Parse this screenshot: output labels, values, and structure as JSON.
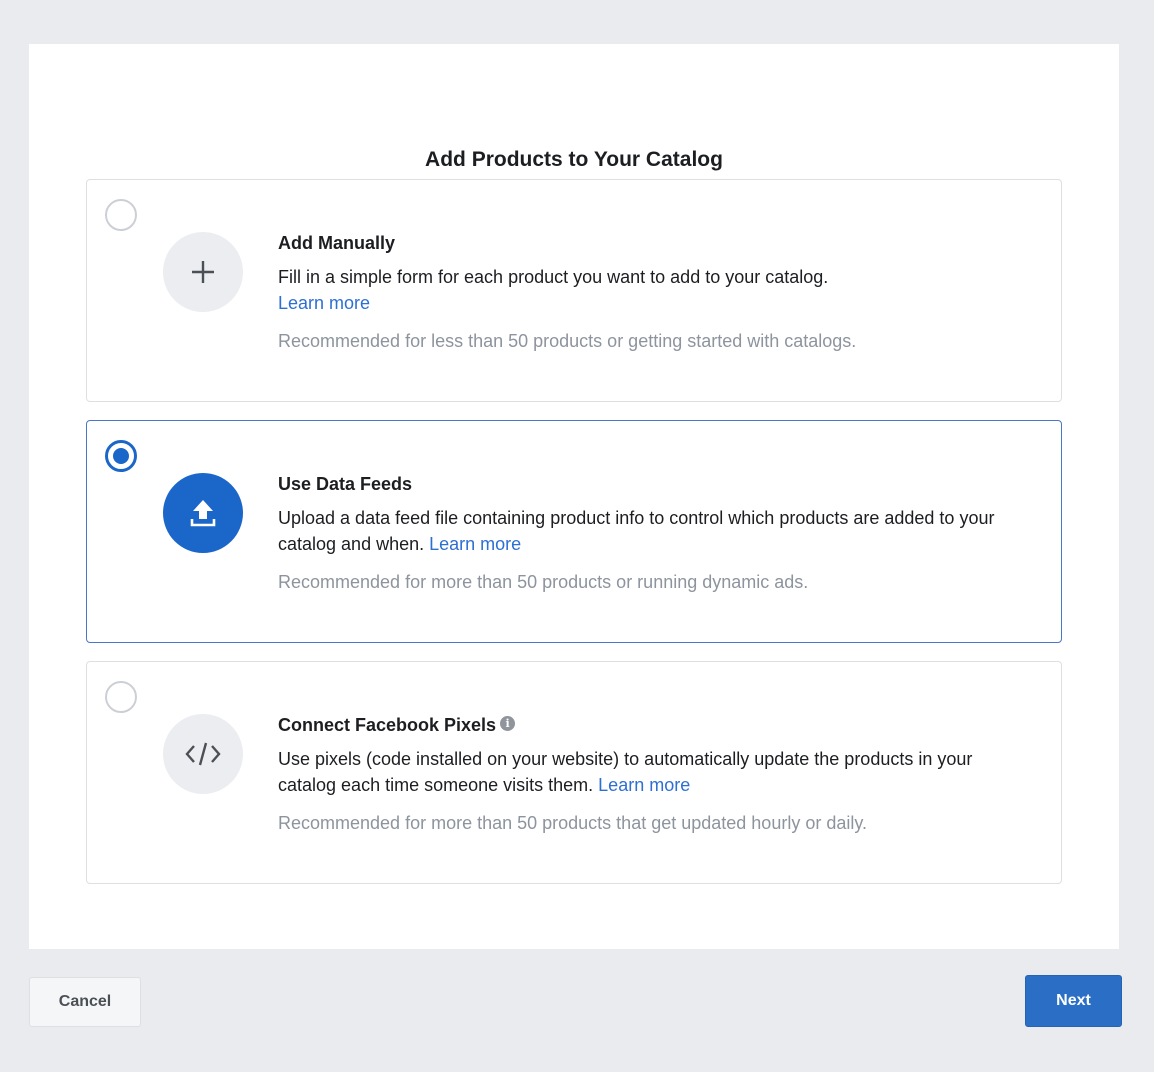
{
  "dialog": {
    "title": "Add Products to Your Catalog"
  },
  "options": [
    {
      "title": "Add Manually",
      "description": "Fill in a simple form for each product you want to add to your catalog.",
      "link_label": "Learn more",
      "recommendation": "Recommended for less than 50 products or getting started with catalogs.",
      "icon": "plus-icon",
      "selected": false
    },
    {
      "title": "Use Data Feeds",
      "description": "Upload a data feed file containing product info to control which products are added to your catalog and when.",
      "link_label": "Learn more",
      "recommendation": "Recommended for more than 50 products or running dynamic ads.",
      "icon": "upload-icon",
      "selected": true
    },
    {
      "title": "Connect Facebook Pixels",
      "description": "Use pixels (code installed on your website) to automatically update the products in your catalog each time someone visits them.",
      "link_label": "Learn more",
      "recommendation": "Recommended for more than 50 products that get updated hourly or daily.",
      "icon": "code-icon",
      "info_icon": "info-icon",
      "selected": false
    }
  ],
  "footer": {
    "cancel_label": "Cancel",
    "next_label": "Next"
  },
  "colors": {
    "accent": "#1b66c9",
    "link": "#2d6fd3",
    "muted_text": "#8d949e",
    "page_background": "#e9ebee"
  }
}
